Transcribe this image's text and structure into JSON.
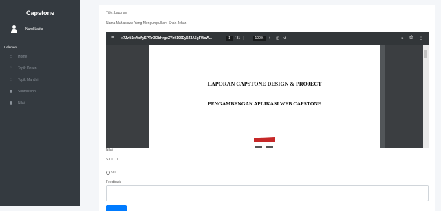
{
  "sidebar": {
    "brand": "Capstone",
    "user_name": "Nurul Latifa",
    "section": "Halaman",
    "items": [
      {
        "label": "Home",
        "icon": "home-icon",
        "glyph": "⌂"
      },
      {
        "label": "Topik Dosen",
        "icon": "chat-icon",
        "glyph": "◌"
      },
      {
        "label": "Topik Mandiri",
        "icon": "chat-icon",
        "glyph": "◌"
      },
      {
        "label": "Submission",
        "icon": "file-icon",
        "glyph": "▮"
      },
      {
        "label": "Nilai",
        "icon": "file-icon",
        "glyph": "▮"
      }
    ]
  },
  "main": {
    "title_line": "Title: Laporan",
    "student_line": "Nama Mahasiswa Yang Mengumpulkan: Shah Jehan",
    "pdf": {
      "filename": "e7Jwb1xAxAySPRn3ObHrgeZYh0100Ey0Z4A5gFWcW...",
      "page_current": "1",
      "page_total": "/ 31",
      "zoom": "100%",
      "minus": "—",
      "plus": "+",
      "doc_title_1": "LAPORAN CAPSTONE DESIGN & PROJECT",
      "doc_title_2": "PENGAMBENGAN APLIKASI WEB CAPSTONE"
    },
    "nilai_label": "Nilai",
    "clo_label": "S CLO1",
    "radio_value": "90",
    "feedback_label": "Feedback"
  }
}
